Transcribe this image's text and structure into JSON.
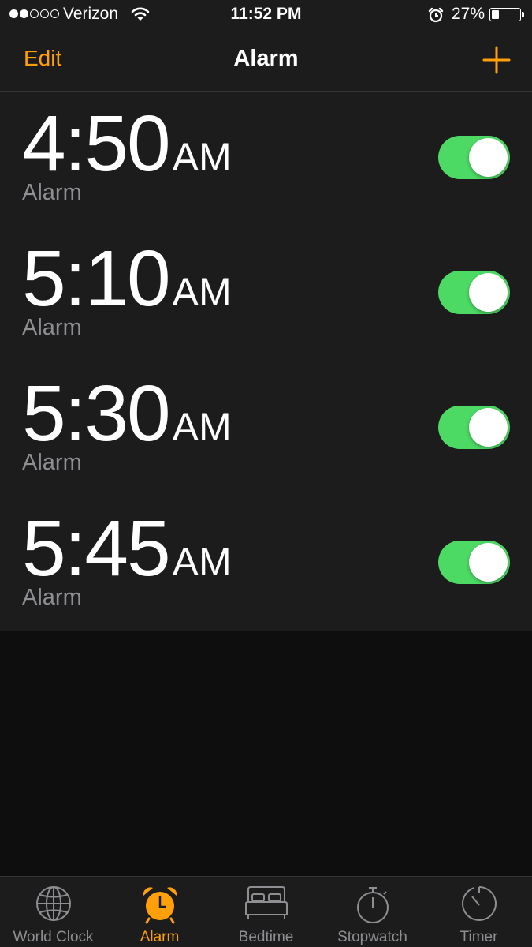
{
  "status_bar": {
    "carrier": "Verizon",
    "signal_bars_filled": 2,
    "signal_bars_total": 5,
    "time": "11:52 PM",
    "battery_percent": "27%",
    "battery_level": 0.27,
    "icons": [
      "wifi-icon",
      "alarm-clock-icon",
      "battery-icon"
    ]
  },
  "nav": {
    "edit_label": "Edit",
    "title": "Alarm",
    "add_icon": "plus-icon"
  },
  "alarms": [
    {
      "time": "4:50",
      "ampm": "AM",
      "label": "Alarm",
      "enabled": true
    },
    {
      "time": "5:10",
      "ampm": "AM",
      "label": "Alarm",
      "enabled": true
    },
    {
      "time": "5:30",
      "ampm": "AM",
      "label": "Alarm",
      "enabled": true
    },
    {
      "time": "5:45",
      "ampm": "AM",
      "label": "Alarm",
      "enabled": true
    }
  ],
  "tabs": [
    {
      "label": "World Clock",
      "icon": "globe-icon",
      "active": false
    },
    {
      "label": "Alarm",
      "icon": "alarm-clock-icon",
      "active": true
    },
    {
      "label": "Bedtime",
      "icon": "bed-icon",
      "active": false
    },
    {
      "label": "Stopwatch",
      "icon": "stopwatch-icon",
      "active": false
    },
    {
      "label": "Timer",
      "icon": "timer-icon",
      "active": false
    }
  ],
  "colors": {
    "accent": "#ff9f0a",
    "toggle_on": "#4cd964",
    "background": "#0e0e0e",
    "surface": "#1c1c1c",
    "secondary_text": "#8e8e93"
  }
}
